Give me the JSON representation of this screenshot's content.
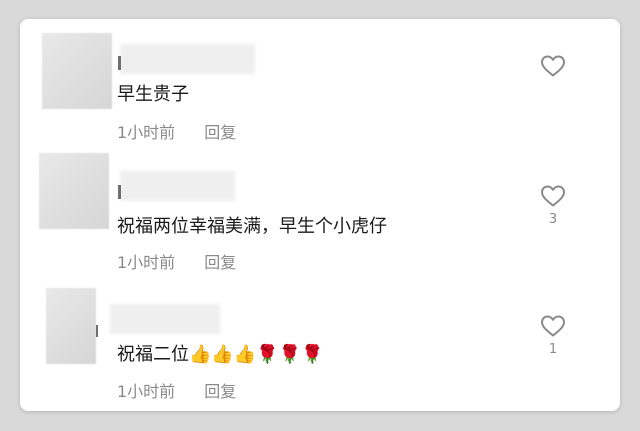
{
  "comments": [
    {
      "text": "早生贵子",
      "time": "1小时前",
      "reply_label": "回复",
      "like_count": "",
      "like_icon": "heart-outline-icon"
    },
    {
      "text": "祝福两位幸福美满，早生个小虎仔",
      "time": "1小时前",
      "reply_label": "回复",
      "like_count": "3",
      "like_icon": "heart-outline-icon"
    },
    {
      "text": "祝福二位👍👍👍🌹🌹🌹",
      "time": "1小时前",
      "reply_label": "回复",
      "like_count": "1",
      "like_icon": "heart-outline-icon"
    }
  ],
  "colors": {
    "text": "#1a1a1a",
    "meta": "#8a8a8a",
    "card": "#ffffff",
    "background": "#d9d9d9"
  }
}
